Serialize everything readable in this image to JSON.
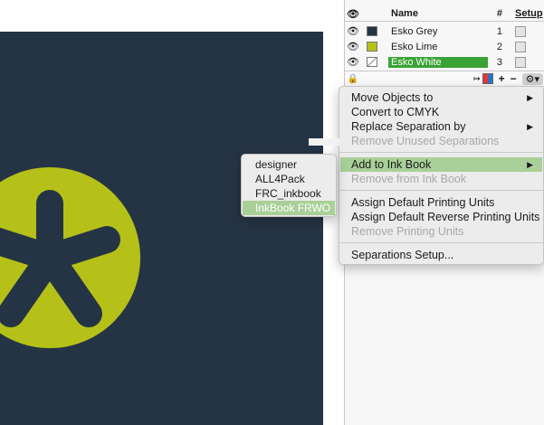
{
  "separations": {
    "headers": {
      "name": "Name",
      "number": "#",
      "setup": "Setup"
    },
    "rows": [
      {
        "name": "Esko Grey",
        "number": "1",
        "color": "#253444"
      },
      {
        "name": "Esko Lime",
        "number": "2",
        "color": "#b5c118"
      },
      {
        "name": "Esko White",
        "number": "3",
        "color": "#ffffff",
        "selected": true
      }
    ],
    "toolbar": {
      "add": "+",
      "remove": "−"
    }
  },
  "context_menu": {
    "items": [
      {
        "label": "Move Objects to",
        "enabled": true,
        "submenu": true
      },
      {
        "label": "Convert to CMYK",
        "enabled": true
      },
      {
        "label": "Replace Separation by",
        "enabled": true,
        "submenu": true
      },
      {
        "label": "Remove Unused Separations",
        "enabled": false
      },
      {
        "label": "Add to Ink Book",
        "enabled": true,
        "submenu": true,
        "highlighted": true
      },
      {
        "label": "Remove from Ink Book",
        "enabled": false
      },
      {
        "label": "Assign Default Printing Units",
        "enabled": true
      },
      {
        "label": "Assign Default Reverse Printing Units",
        "enabled": true
      },
      {
        "label": "Remove Printing Units",
        "enabled": false
      },
      {
        "label": "Separations Setup...",
        "enabled": true
      }
    ]
  },
  "ink_book_submenu": {
    "items": [
      {
        "label": "designer"
      },
      {
        "label": "ALL4Pack"
      },
      {
        "label": "FRC_inkbook"
      },
      {
        "label": "InkBook FRWO",
        "highlighted": true
      }
    ]
  },
  "colors": {
    "accent_selection": "#39a335",
    "menu_highlight": "#a9d098",
    "artwork_bg": "#253444",
    "logo_lime": "#b5c118"
  }
}
